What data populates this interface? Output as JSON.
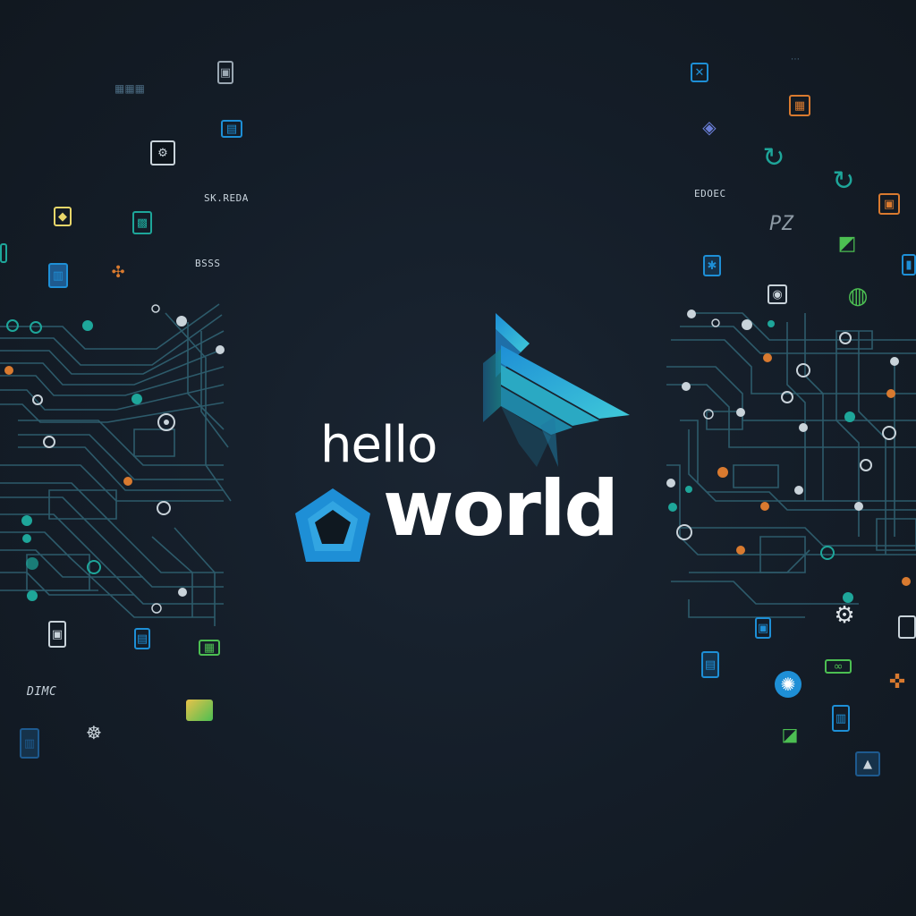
{
  "headline": {
    "line1": "hello",
    "line2": "world"
  },
  "colors": {
    "background": "#131c26",
    "circuit_line": "#2f5f6f",
    "accent_cyan": "#3fc9d8",
    "accent_blue": "#1e8fd6",
    "accent_teal": "#1ea69a",
    "accent_orange": "#d97a2f",
    "accent_green": "#4cbf52",
    "text_white": "#ffffff"
  },
  "icons": {
    "hex_logo": "hexagon-logo-icon",
    "arrow_logo": "chevron-stripes-logo-icon"
  },
  "scatter_labels": {
    "left_top": "SK.REDA",
    "left_mid": "BSSS",
    "left_bottom": "DIMC",
    "right_top": "EDOEC",
    "right_big": "PZ"
  }
}
